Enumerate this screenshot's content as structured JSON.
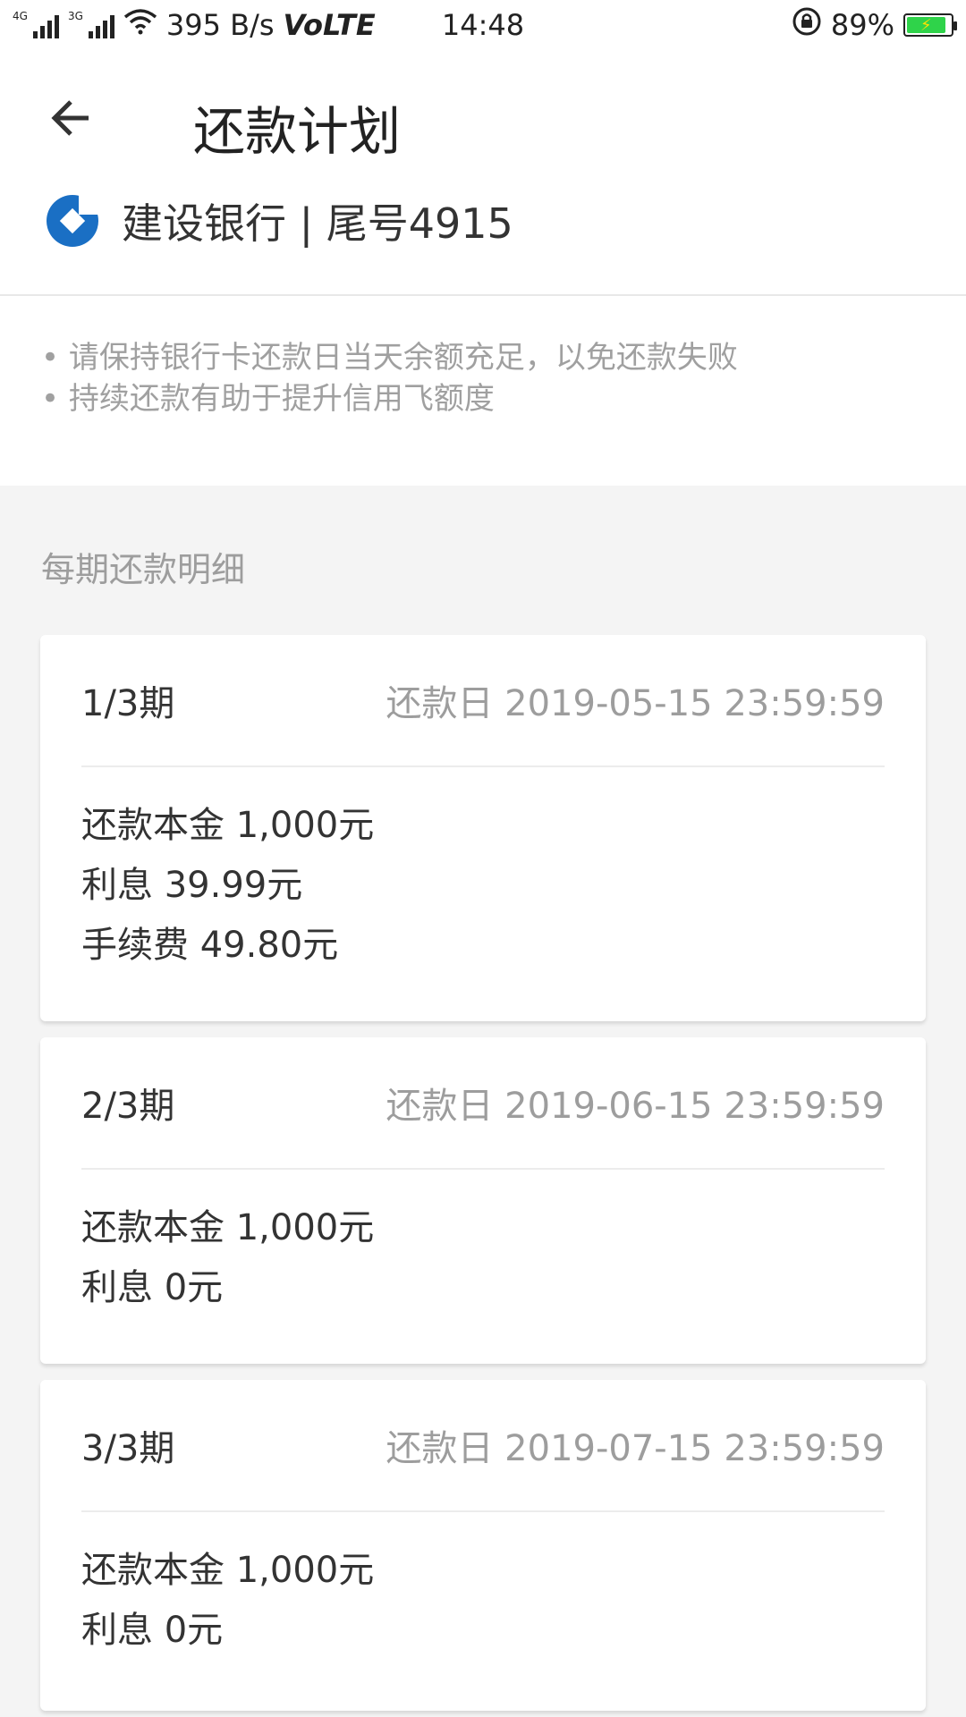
{
  "status_bar": {
    "net_type_1": "4G",
    "net_type_2": "3G",
    "speed": "395 B/s",
    "volte": "VoLTE",
    "time": "14:48",
    "battery_percent": "89%",
    "battery_level": 0.89,
    "icons": [
      "signal-icon",
      "signal-icon",
      "wifi-icon",
      "rotation-lock-icon",
      "battery-icon"
    ]
  },
  "header": {
    "back_icon": "back-arrow-icon",
    "title": "还款计划"
  },
  "bank": {
    "logo_icon": "ccb-logo-icon",
    "logo_color": "#1a6fc4",
    "label": "建设银行 | 尾号4915"
  },
  "tips": [
    "• 请保持银行卡还款日当天余额充足，以免还款失败",
    "• 持续还款有助于提升信用飞额度"
  ],
  "section_title": "每期还款明细",
  "installments": [
    {
      "period": "1/3期",
      "due": "还款日 2019-05-15 23:59:59",
      "lines": [
        "还款本金 1,000元",
        "利息 39.99元",
        "手续费 49.80元"
      ]
    },
    {
      "period": "2/3期",
      "due": "还款日 2019-06-15 23:59:59",
      "lines": [
        "还款本金 1,000元",
        "利息 0元"
      ]
    },
    {
      "period": "3/3期",
      "due": "还款日 2019-07-15 23:59:59",
      "lines": [
        "还款本金 1,000元",
        "利息 0元"
      ]
    }
  ]
}
